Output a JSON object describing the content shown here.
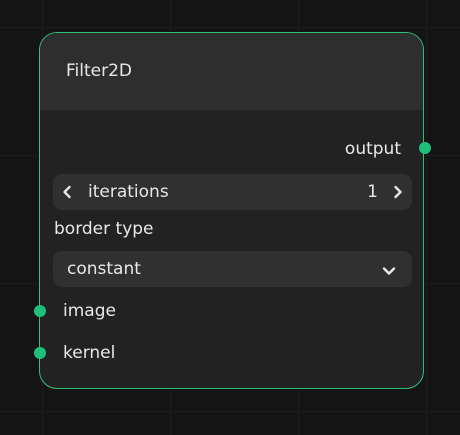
{
  "node": {
    "title": "Filter2D",
    "outputs": [
      {
        "label": "output"
      }
    ],
    "stepper": {
      "label": "iterations",
      "value": "1"
    },
    "border_type": {
      "label": "border type",
      "selected": "constant"
    },
    "inputs": [
      {
        "label": "image"
      },
      {
        "label": "kernel"
      }
    ]
  },
  "colors": {
    "accent": "#1fbf7a",
    "node_border": "#2fbf7a",
    "node_body": "#222222",
    "node_header": "#2e2e2e",
    "control_bg": "#303030",
    "canvas_bg": "#141414"
  },
  "icons": {
    "decrement": "chevron-left-icon",
    "increment": "chevron-right-icon",
    "dropdown": "chevron-down-icon"
  }
}
